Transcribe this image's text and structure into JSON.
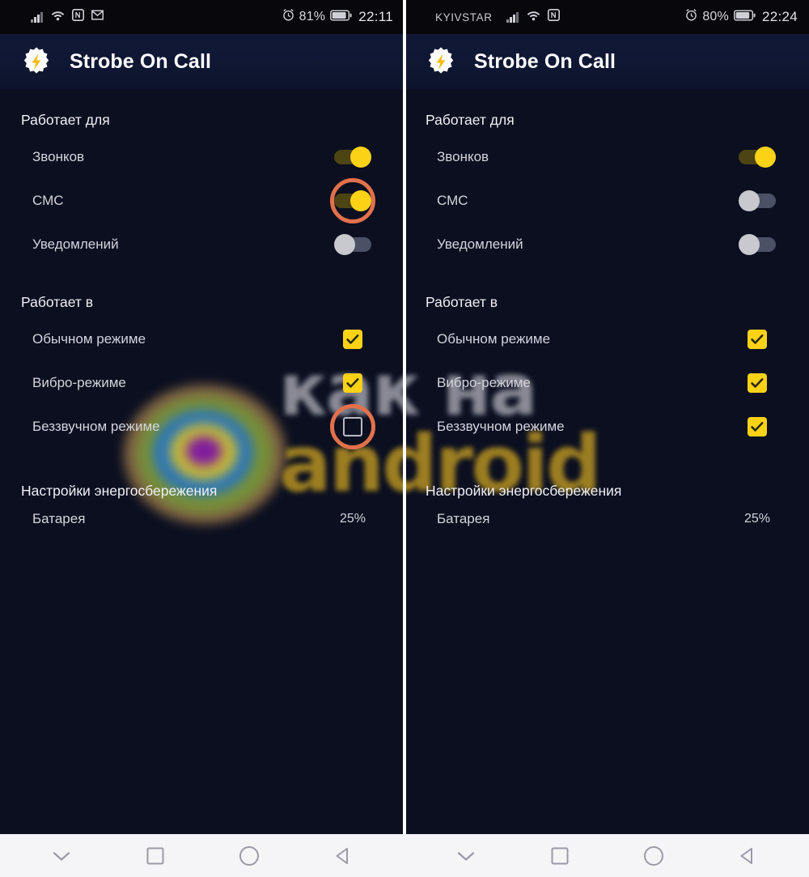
{
  "app": {
    "title": "Strobe On Call",
    "icon": "lightning-badge-icon",
    "accent_yellow": "#FCD217",
    "highlight_orange": "#E2714C",
    "background": "#0B0F20",
    "header_background": "#101837"
  },
  "watermark": {
    "line1": "как на",
    "line2": "android"
  },
  "panels": [
    {
      "id": "left",
      "status_bar": {
        "carrier": "",
        "icons": [
          "signal-icon",
          "wifi-icon",
          "nfc-icon",
          "gmail-icon"
        ],
        "alarm_icon": "alarm-icon",
        "battery_percent": "81%",
        "battery_icon": "battery-icon",
        "clock": "22:11"
      },
      "sections": [
        {
          "title": "Работает для",
          "type": "switch",
          "rows": [
            {
              "label": "Звонков",
              "state": "on",
              "highlighted": false
            },
            {
              "label": "СМС",
              "state": "on",
              "highlighted": true
            },
            {
              "label": "Уведомлений",
              "state": "off",
              "highlighted": false
            }
          ]
        },
        {
          "title": "Работает в",
          "type": "checkbox",
          "rows": [
            {
              "label": "Обычном режиме",
              "state": "checked",
              "highlighted": false
            },
            {
              "label": "Вибро-режиме",
              "state": "checked",
              "highlighted": false
            },
            {
              "label": "Беззвучном режиме",
              "state": "unchecked",
              "highlighted": true
            }
          ]
        },
        {
          "title": "Настройки энергосбережения",
          "type": "value",
          "rows": [
            {
              "label": "Батарея",
              "value": "25%"
            }
          ]
        }
      ]
    },
    {
      "id": "right",
      "status_bar": {
        "carrier": "KYIVSTAR",
        "icons": [
          "signal-icon",
          "wifi-icon",
          "nfc-icon"
        ],
        "alarm_icon": "alarm-icon",
        "battery_percent": "80%",
        "battery_icon": "battery-icon",
        "clock": "22:24"
      },
      "sections": [
        {
          "title": "Работает для",
          "type": "switch",
          "rows": [
            {
              "label": "Звонков",
              "state": "on",
              "highlighted": false
            },
            {
              "label": "СМС",
              "state": "off",
              "highlighted": false
            },
            {
              "label": "Уведомлений",
              "state": "off",
              "highlighted": false
            }
          ]
        },
        {
          "title": "Работает в",
          "type": "checkbox",
          "rows": [
            {
              "label": "Обычном режиме",
              "state": "checked",
              "highlighted": false
            },
            {
              "label": "Вибро-режиме",
              "state": "checked",
              "highlighted": false
            },
            {
              "label": "Беззвучном режиме",
              "state": "checked",
              "highlighted": false
            }
          ]
        },
        {
          "title": "Настройки энергосбережения",
          "type": "value",
          "rows": [
            {
              "label": "Батарея",
              "value": "25%"
            }
          ]
        }
      ]
    }
  ],
  "navbar": {
    "buttons": [
      {
        "icon": "chevron-down-icon",
        "name": "hide-keyboard-button"
      },
      {
        "icon": "square-icon",
        "name": "recents-button"
      },
      {
        "icon": "circle-icon",
        "name": "home-button"
      },
      {
        "icon": "triangle-left-icon",
        "name": "back-button"
      }
    ]
  }
}
